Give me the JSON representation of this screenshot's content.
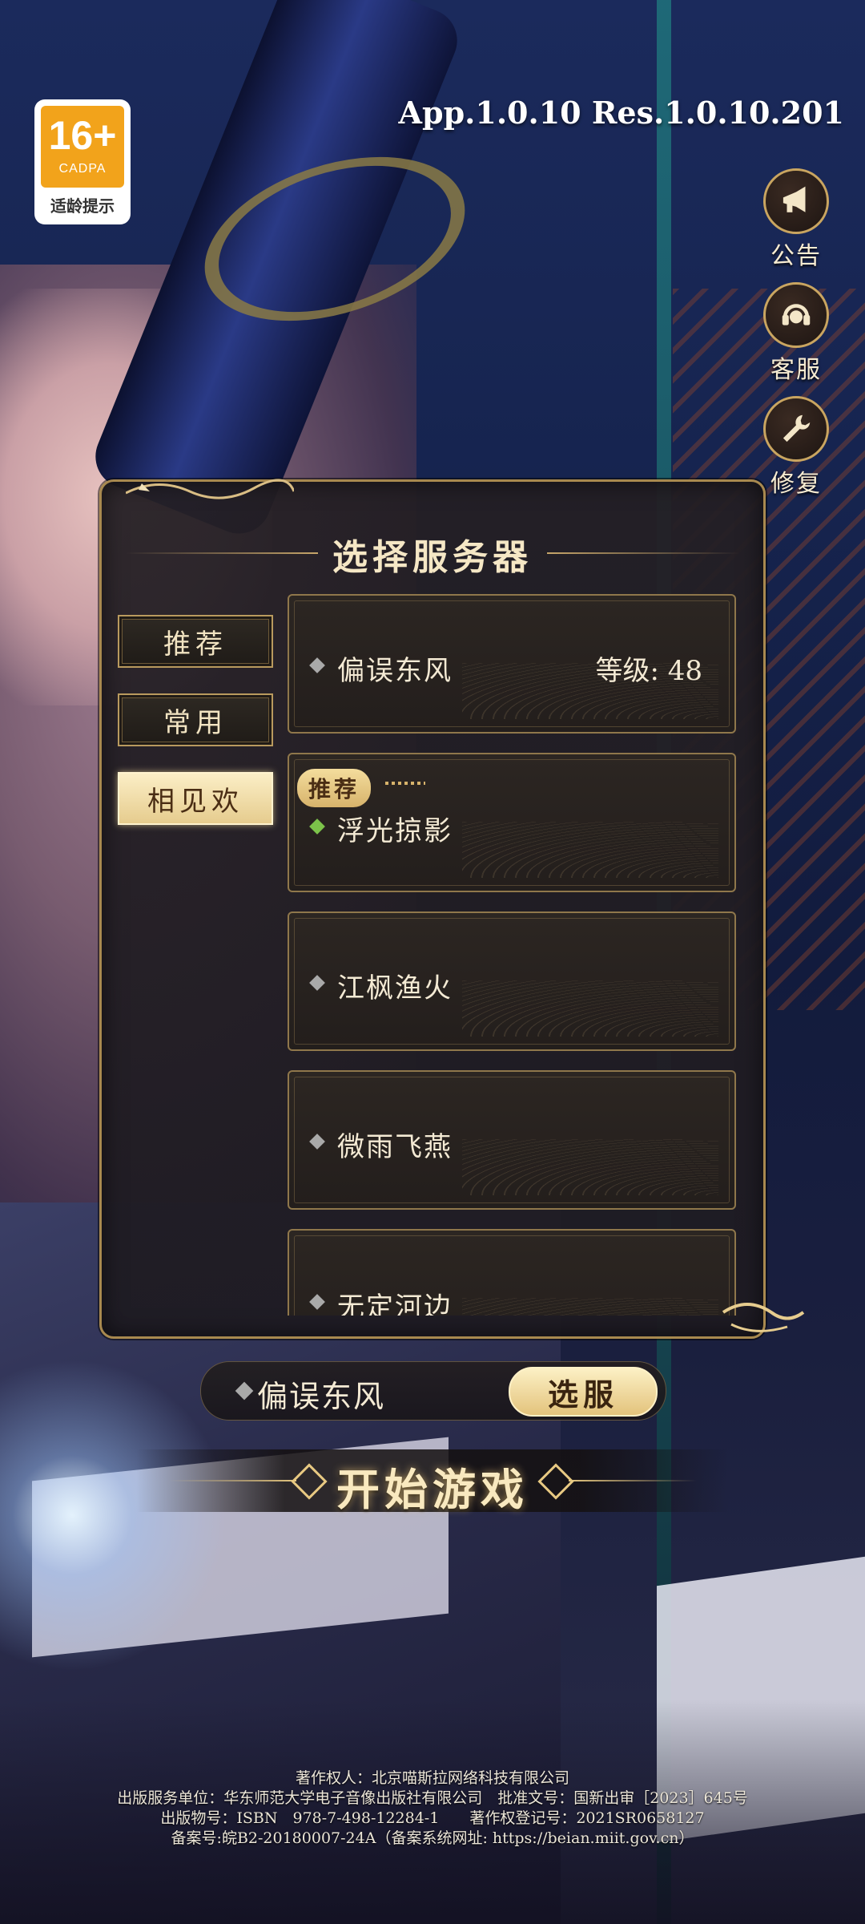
{
  "age_rating": {
    "number": "16+",
    "org": "CADPA",
    "tip": "适龄提示"
  },
  "version": "App.1.0.10 Res.1.0.10.201",
  "side_buttons": [
    {
      "label": "公告",
      "icon": "megaphone-icon"
    },
    {
      "label": "客服",
      "icon": "headset-icon"
    },
    {
      "label": "修复",
      "icon": "wrench-icon"
    }
  ],
  "panel": {
    "title": "选择服务器",
    "tabs": [
      {
        "label": "推荐",
        "active": false
      },
      {
        "label": "常用",
        "active": false
      },
      {
        "label": "相见欢",
        "active": true
      }
    ],
    "servers": [
      {
        "name": "偏误东风",
        "level": "等级: 48",
        "status": "gray",
        "tag": ""
      },
      {
        "name": "浮光掠影",
        "level": "",
        "status": "green",
        "tag": "推荐"
      },
      {
        "name": "江枫渔火",
        "level": "",
        "status": "gray",
        "tag": ""
      },
      {
        "name": "微雨飞燕",
        "level": "",
        "status": "gray",
        "tag": ""
      },
      {
        "name": "无定河边",
        "level": "",
        "status": "gray",
        "tag": ""
      }
    ]
  },
  "selected_server": {
    "name": "偏误东风",
    "button": "选服"
  },
  "start_button": "开始游戏",
  "footer": [
    "著作权人：北京喵斯拉网络科技有限公司",
    "出版服务单位：华东师范大学电子音像出版社有限公司　批准文号：国新出审［2023］645号",
    "出版物号：ISBN　978-7-498-12284-1　　著作权登记号：2021SR0658127",
    "备案号:皖B2-20180007-24A（备案系统网址: https://beian.miit.gov.cn）"
  ],
  "colors": {
    "gold": "#c9a560",
    "active_tab": "#e6cc8e",
    "status_green": "#7cc34a",
    "status_gray": "#a9a9a9",
    "age_orange": "#f2a31b"
  }
}
